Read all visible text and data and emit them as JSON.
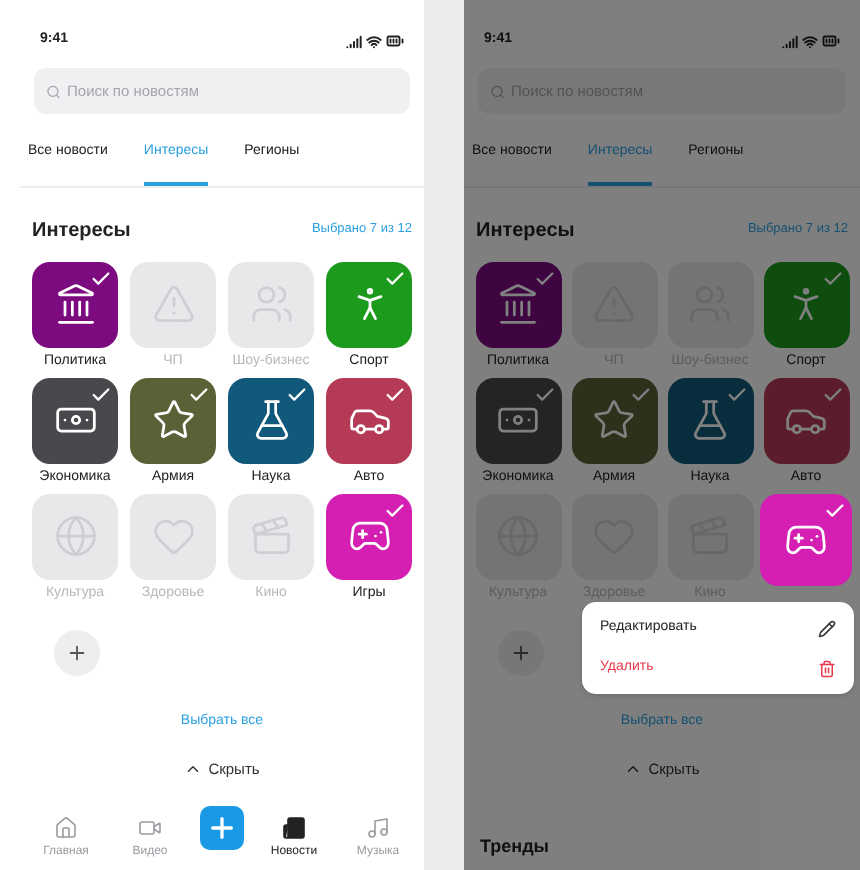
{
  "screens": [
    {
      "dimmed": false,
      "status_time": "9:41",
      "search": {
        "placeholder": "Поиск по новостям"
      },
      "tabs": [
        {
          "label": "Все новости",
          "selected": false
        },
        {
          "label": "Интересы",
          "selected": true
        },
        {
          "label": "Регионы",
          "selected": false
        }
      ],
      "section_title": "Интересы",
      "selected_count": "Выбрано 7 из 12",
      "topics": [
        {
          "label": "Политика",
          "selected": true,
          "color": "#7c0b80"
        },
        {
          "label": "ЧП",
          "selected": false
        },
        {
          "label": "Шоу-бизнес",
          "selected": false
        },
        {
          "label": "Спорт",
          "selected": true,
          "color": "#1c9a1c"
        },
        {
          "label": "Экономика",
          "selected": true,
          "color": "#48484d"
        },
        {
          "label": "Армия",
          "selected": true,
          "color": "#5a6136"
        },
        {
          "label": "Наука",
          "selected": true,
          "color": "#10597a"
        },
        {
          "label": "Авто",
          "selected": true,
          "color": "#b53a55"
        },
        {
          "label": "Культура",
          "selected": false
        },
        {
          "label": "Здоровье",
          "selected": false
        },
        {
          "label": "Кино",
          "selected": false
        },
        {
          "label": "Игры",
          "selected": true,
          "color": "#d41fb2"
        }
      ],
      "select_all": "Выбрать все",
      "hide": "Скрыть",
      "bottom_nav": [
        {
          "label": "Главная",
          "selected": false
        },
        {
          "label": "Видео",
          "selected": false
        },
        {
          "kind": "add"
        },
        {
          "label": "Новости",
          "selected": true
        },
        {
          "label": "Музыка",
          "selected": false
        }
      ]
    },
    {
      "dimmed": true,
      "status_time": "9:41",
      "search": {
        "placeholder": "Поиск по новостям"
      },
      "tabs": [
        {
          "label": "Все новости",
          "selected": false
        },
        {
          "label": "Интересы",
          "selected": true
        },
        {
          "label": "Регионы",
          "selected": false
        }
      ],
      "section_title": "Интересы",
      "selected_count": "Выбрано 7 из 12",
      "topics": [
        {
          "label": "Политика",
          "selected": true,
          "color": "#3e0540"
        },
        {
          "label": "ЧП",
          "selected": false
        },
        {
          "label": "Шоу-бизнес",
          "selected": false
        },
        {
          "label": "Спорт",
          "selected": true,
          "color": "#0e4d0e"
        },
        {
          "label": "Экономика",
          "selected": true,
          "color": "#242427"
        },
        {
          "label": "Армия",
          "selected": true,
          "color": "#2d311b"
        },
        {
          "label": "Наука",
          "selected": true,
          "color": "#082d3d"
        },
        {
          "label": "Авто",
          "selected": true,
          "color": "#5b1d2b"
        },
        {
          "label": "Культура",
          "selected": false
        },
        {
          "label": "Здоровье",
          "selected": false
        },
        {
          "label": "Кино",
          "selected": false
        },
        {
          "selected": true,
          "color": "#d41fb2",
          "highlighted": true
        }
      ],
      "context_menu": [
        {
          "label": "Редактировать",
          "kind": "edit"
        },
        {
          "label": "Удалить",
          "kind": "delete"
        }
      ],
      "select_all": "Выбрать все",
      "hide": "Скрыть",
      "trends_title": "Тренды"
    }
  ]
}
